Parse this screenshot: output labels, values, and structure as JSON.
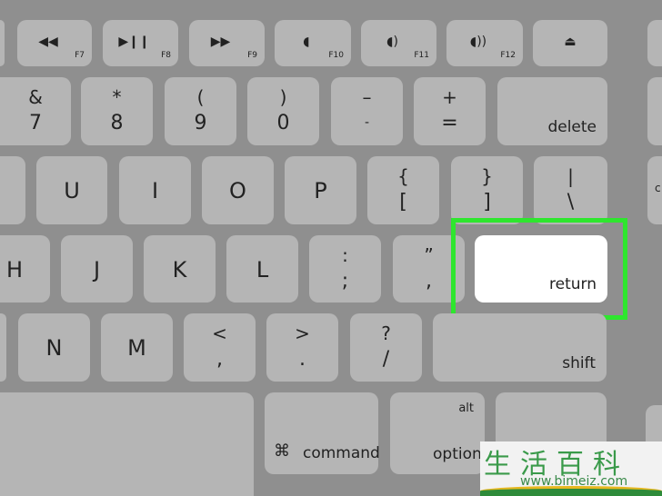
{
  "fn_row": [
    {
      "icon": "rewind-icon",
      "glyph": "◀◀",
      "label": "F7"
    },
    {
      "icon": "play-pause-icon",
      "glyph": "▶❙❙",
      "label": "F8"
    },
    {
      "icon": "fast-forward-icon",
      "glyph": "▶▶",
      "label": "F9"
    },
    {
      "icon": "mute-icon",
      "glyph": "◖",
      "label": "F10"
    },
    {
      "icon": "volume-down-icon",
      "glyph": "◖)",
      "label": "F11"
    },
    {
      "icon": "volume-up-icon",
      "glyph": "◖))",
      "label": "F12"
    },
    {
      "icon": "eject-icon",
      "glyph": "⏏"
    }
  ],
  "number_row": [
    {
      "top": "&",
      "bottom": "7"
    },
    {
      "top": "*",
      "bottom": "8"
    },
    {
      "top": "(",
      "bottom": "9"
    },
    {
      "top": ")",
      "bottom": "0"
    },
    {
      "top": "–",
      "bottom": "-"
    },
    {
      "top": "+",
      "bottom": "="
    },
    {
      "label": "delete"
    }
  ],
  "row3": [
    {
      "label": "U"
    },
    {
      "label": "I"
    },
    {
      "label": "O"
    },
    {
      "label": "P"
    },
    {
      "top": "{",
      "bottom": "["
    },
    {
      "top": "}",
      "bottom": "]"
    },
    {
      "top": "|",
      "bottom": "\\"
    }
  ],
  "row3_partial": "c",
  "row4": [
    {
      "label": "H"
    },
    {
      "label": "J"
    },
    {
      "label": "K"
    },
    {
      "label": "L"
    },
    {
      "top": ":",
      "bottom": ";"
    },
    {
      "top": "”",
      "bottom": ","
    },
    {
      "label": "return"
    }
  ],
  "row5": [
    {
      "label": "N"
    },
    {
      "label": "M"
    },
    {
      "top": "<",
      "bottom": ","
    },
    {
      "top": ">",
      "bottom": "."
    },
    {
      "top": "?",
      "bottom": "/"
    },
    {
      "label": "shift"
    }
  ],
  "row6": {
    "command_icon": "⌘",
    "command": "command",
    "alt": "alt",
    "option": "option"
  },
  "highlight_color": "#2ee62e",
  "watermark": {
    "chars": "生活百科",
    "url": "www.bimeiz.com"
  }
}
